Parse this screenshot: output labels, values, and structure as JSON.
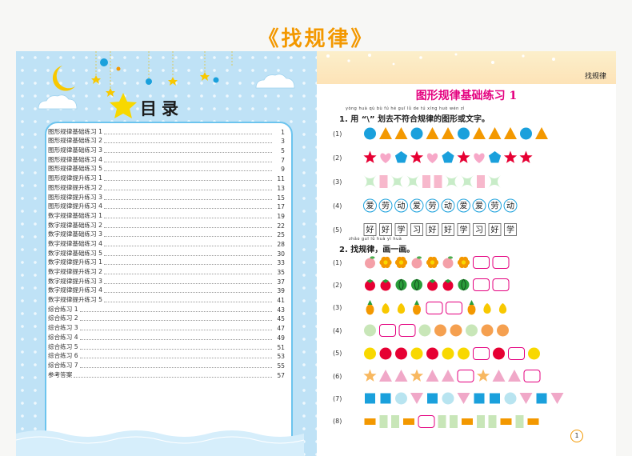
{
  "banner": {
    "title": "《找规律》"
  },
  "toc": {
    "title": "目录",
    "items": [
      {
        "label": "图形规律基础练习 1",
        "page": "1"
      },
      {
        "label": "图形规律基础练习 2",
        "page": "3"
      },
      {
        "label": "图形规律基础练习 3",
        "page": "5"
      },
      {
        "label": "图形规律基础练习 4",
        "page": "7"
      },
      {
        "label": "图形规律基础练习 5",
        "page": "9"
      },
      {
        "label": "图形规律提升练习 1",
        "page": "11"
      },
      {
        "label": "图形规律提升练习 2",
        "page": "13"
      },
      {
        "label": "图形规律提升练习 3",
        "page": "15"
      },
      {
        "label": "图形规律提升练习 4",
        "page": "17"
      },
      {
        "label": "数字规律基础练习 1",
        "page": "19"
      },
      {
        "label": "数字规律基础练习 2",
        "page": "22"
      },
      {
        "label": "数字规律基础练习 3",
        "page": "25"
      },
      {
        "label": "数字规律基础练习 4",
        "page": "28"
      },
      {
        "label": "数字规律基础练习 5",
        "page": "30"
      },
      {
        "label": "数字规律提升练习 1",
        "page": "33"
      },
      {
        "label": "数字规律提升练习 2",
        "page": "35"
      },
      {
        "label": "数字规律提升练习 3",
        "page": "37"
      },
      {
        "label": "数字规律提升练习 4",
        "page": "39"
      },
      {
        "label": "数字规律提升练习 5",
        "page": "41"
      },
      {
        "label": "综合练习 1",
        "page": "43"
      },
      {
        "label": "综合练习 2",
        "page": "45"
      },
      {
        "label": "综合练习 3",
        "page": "47"
      },
      {
        "label": "综合练习 4",
        "page": "49"
      },
      {
        "label": "综合练习 5",
        "page": "51"
      },
      {
        "label": "综合练习 6",
        "page": "53"
      },
      {
        "label": "综合练习 7",
        "page": "55"
      },
      {
        "label": "参考答案",
        "page": "57"
      }
    ]
  },
  "right": {
    "header_label": "找规律",
    "page_title": "图形规律基础练习 1",
    "page_number": "1",
    "q1": {
      "text": "1. 用 “\\” 划去不符合规律的图形或文字。",
      "pinyin": "yòng      huà qù bù fú hé guī lǜ de tú xíng huò wén zì",
      "rows": [
        {
          "label": "(1)",
          "items": [
            "circle:#1aa0dc",
            "tri:#f39800",
            "tri:#f39800",
            "circle:#1aa0dc",
            "tri:#f39800",
            "tri:#f39800",
            "circle:#1aa0dc",
            "tri:#f39800",
            "tri:#f39800",
            "tri:#f39800",
            "circle:#1aa0dc",
            "tri:#f39800"
          ]
        },
        {
          "label": "(2)",
          "items": [
            "star:#e60033",
            "heart:#f7a8c8",
            "pent:#1aa0dc",
            "star:#e60033",
            "heart:#f7a8c8",
            "pent:#1aa0dc",
            "star:#e60033",
            "heart:#f7a8c8",
            "pent:#1aa0dc",
            "star:#e60033",
            "star:#e60033"
          ]
        },
        {
          "label": "(3)",
          "items": [
            "sparkle:#c8ecc8",
            "rect:#f7b8cc",
            "sparkle:#c8ecc8",
            "sparkle:#c8ecc8",
            "rect:#f7b8cc",
            "rect:#f7b8cc",
            "sparkle:#c8ecc8",
            "sparkle:#c8ecc8",
            "rect:#f7b8cc",
            "sparkle:#c8ecc8"
          ]
        },
        {
          "label": "(4)",
          "items": [
            "circleText:爱",
            "circleText:劳",
            "circleText:动",
            "circleText:爱",
            "circleText:劳",
            "circleText:动",
            "circleText:爱",
            "circleText:爱",
            "circleText:劳",
            "circleText:动"
          ]
        },
        {
          "label": "(5)",
          "items": [
            "boxText:好",
            "boxText:好",
            "boxText:学",
            "boxText:习",
            "boxText:好",
            "boxText:好",
            "boxText:学",
            "boxText:习",
            "boxText:好",
            "boxText:学"
          ]
        }
      ]
    },
    "q2": {
      "text": "2. 找规律，画一画。",
      "pinyin": "zhǎo guī lǜ    huà yì huà",
      "rows": [
        {
          "label": "(1)",
          "items": [
            "peach:#f4a0a8",
            "flower:#f39800",
            "flower:#f39800",
            "peach:#f4a0a8",
            "flower:#f39800",
            "peach:#f4a0a8",
            "flower:#f39800",
            "blank:",
            "blank:"
          ]
        },
        {
          "label": "(2)",
          "items": [
            "tomato:#e60033",
            "tomato:#e60033",
            "melon:#2a9d3a",
            "melon:#2a9d3a",
            "tomato:#e60033",
            "tomato:#e60033",
            "melon:#2a9d3a",
            "blank:",
            "blank:"
          ]
        },
        {
          "label": "(3)",
          "items": [
            "pine:#f39800",
            "pear:#f8c800",
            "pear:#f8c800",
            "pine:#f39800",
            "blank:",
            "blank:",
            "pine:#f39800",
            "pear:#f8c800",
            "pear:#f8c800"
          ]
        },
        {
          "label": "(4)",
          "items": [
            "circle:#c8e6b8",
            "blank:",
            "blank:",
            "circle:#c8e6b8",
            "circle:#f5a050",
            "circle:#f5a050",
            "circle:#c8e6b8",
            "circle:#f5a050",
            "circle:#f5a050"
          ]
        },
        {
          "label": "(5)",
          "items": [
            "circle:#f8d800",
            "circle:#e60033",
            "circle:#e60033",
            "circle:#f8d800",
            "circle:#e60033",
            "circle:#f8d800",
            "circle:#f8d800",
            "blank:",
            "circle:#e60033",
            "blank:",
            "circle:#f8d800"
          ]
        },
        {
          "label": "(6)",
          "items": [
            "star:#f8b860",
            "tri:#f0a8c8",
            "tri:#f0a8c8",
            "star:#f8b860",
            "tri:#f0a8c8",
            "tri:#f0a8c8",
            "blank:",
            "star:#f8b860",
            "tri:#f0a8c8",
            "tri:#f0a8c8",
            "blank:"
          ]
        },
        {
          "label": "(7)",
          "items": [
            "sq:#1aa0dc",
            "sq:#1aa0dc",
            "circle:#b8e4f0",
            "dtri:#f0a8c8",
            "sq:#1aa0dc",
            "circle:#b8e4f0",
            "dtri:#f0a8c8",
            "sq:#1aa0dc",
            "sq:#1aa0dc",
            "circle:#b8e4f0",
            "dtri:#f0a8c8",
            "sq:#1aa0dc",
            "dtri:#f0a8c8"
          ]
        },
        {
          "label": "(8)",
          "items": [
            "bar:#f39800",
            "tall:#c8e6b8",
            "tall:#c8e6b8",
            "bar:#f39800",
            "blank:",
            "tall:#c8e6b8",
            "tall:#c8e6b8",
            "bar:#f39800",
            "tall:#c8e6b8",
            "tall:#c8e6b8",
            "bar:#f39800",
            "tall:#c8e6b8",
            "bar:#f39800"
          ]
        }
      ]
    }
  }
}
